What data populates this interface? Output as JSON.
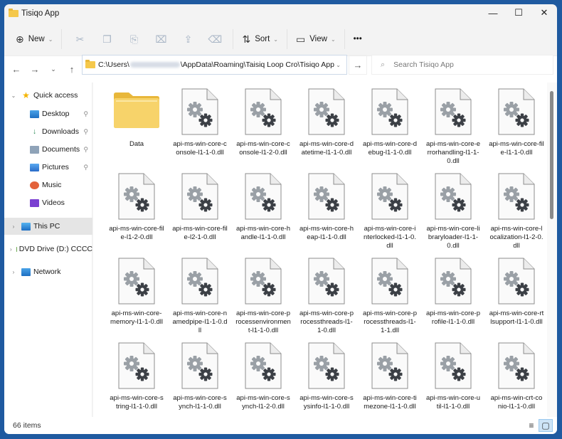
{
  "window": {
    "title": "Tisiqo App",
    "controls": {
      "minimize": "—",
      "maximize": "☐",
      "close": "✕"
    }
  },
  "toolbar": {
    "new_label": "New",
    "sort_label": "Sort",
    "view_label": "View",
    "more_label": "•••",
    "icons": {
      "new": "⊕",
      "cut": "✂",
      "copy": "❐",
      "paste": "📋",
      "rename": "⌧",
      "share": "⇪",
      "delete": "🗑",
      "sort": "⇅",
      "view": "▭"
    }
  },
  "navigation": {
    "back": "←",
    "forward": "→",
    "recent": "⌄",
    "up": "↑",
    "address_prefix": "C:\\Users\\",
    "address_suffix": "\\AppData\\Roaming\\Taisiq Loop Cro\\Tisiqo App",
    "refresh": "→",
    "search_placeholder": "Search Tisiqo App",
    "search_icon": "⌕"
  },
  "sidebar": {
    "items": [
      {
        "label": "Quick access",
        "icon": "star-icon",
        "expander": "⌄",
        "pinned": false
      },
      {
        "label": "Desktop",
        "icon": "desktop-icon",
        "pinned": true
      },
      {
        "label": "Downloads",
        "icon": "download-icon",
        "pinned": true
      },
      {
        "label": "Documents",
        "icon": "documents-icon",
        "pinned": true
      },
      {
        "label": "Pictures",
        "icon": "pictures-icon",
        "pinned": true
      },
      {
        "label": "Music",
        "icon": "music-icon",
        "pinned": false
      },
      {
        "label": "Videos",
        "icon": "videos-icon",
        "pinned": false
      },
      {
        "label": "This PC",
        "icon": "computer-icon",
        "expander": "›",
        "selected": true
      },
      {
        "label": "DVD Drive (D:) CCCC",
        "icon": "dvd-icon",
        "expander": "›"
      },
      {
        "label": "Network",
        "icon": "network-icon",
        "expander": "›"
      }
    ],
    "pin_glyph": "📌"
  },
  "files": [
    {
      "name": "Data",
      "type": "folder"
    },
    {
      "name": "api-ms-win-core-console-l1-1-0.dll",
      "type": "dll"
    },
    {
      "name": "api-ms-win-core-console-l1-2-0.dll",
      "type": "dll"
    },
    {
      "name": "api-ms-win-core-datetime-l1-1-0.dll",
      "type": "dll"
    },
    {
      "name": "api-ms-win-core-debug-l1-1-0.dll",
      "type": "dll"
    },
    {
      "name": "api-ms-win-core-errorhandling-l1-1-0.dll",
      "type": "dll"
    },
    {
      "name": "api-ms-win-core-file-l1-1-0.dll",
      "type": "dll"
    },
    {
      "name": "api-ms-win-core-file-l1-2-0.dll",
      "type": "dll"
    },
    {
      "name": "api-ms-win-core-file-l2-1-0.dll",
      "type": "dll"
    },
    {
      "name": "api-ms-win-core-handle-l1-1-0.dll",
      "type": "dll"
    },
    {
      "name": "api-ms-win-core-heap-l1-1-0.dll",
      "type": "dll"
    },
    {
      "name": "api-ms-win-core-interlocked-l1-1-0.dll",
      "type": "dll"
    },
    {
      "name": "api-ms-win-core-libraryloader-l1-1-0.dll",
      "type": "dll"
    },
    {
      "name": "api-ms-win-core-localization-l1-2-0.dll",
      "type": "dll"
    },
    {
      "name": "api-ms-win-core-memory-l1-1-0.dll",
      "type": "dll"
    },
    {
      "name": "api-ms-win-core-namedpipe-l1-1-0.dll",
      "type": "dll"
    },
    {
      "name": "api-ms-win-core-processenvironment-l1-1-0.dll",
      "type": "dll"
    },
    {
      "name": "api-ms-win-core-processthreads-l1-1-0.dll",
      "type": "dll"
    },
    {
      "name": "api-ms-win-core-processthreads-l1-1-1.dll",
      "type": "dll"
    },
    {
      "name": "api-ms-win-core-profile-l1-1-0.dll",
      "type": "dll"
    },
    {
      "name": "api-ms-win-core-rtlsupport-l1-1-0.dll",
      "type": "dll"
    },
    {
      "name": "api-ms-win-core-string-l1-1-0.dll",
      "type": "dll"
    },
    {
      "name": "api-ms-win-core-synch-l1-1-0.dll",
      "type": "dll"
    },
    {
      "name": "api-ms-win-core-synch-l1-2-0.dll",
      "type": "dll"
    },
    {
      "name": "api-ms-win-core-sysinfo-l1-1-0.dll",
      "type": "dll"
    },
    {
      "name": "api-ms-win-core-timezone-l1-1-0.dll",
      "type": "dll"
    },
    {
      "name": "api-ms-win-core-util-l1-1-0.dll",
      "type": "dll"
    },
    {
      "name": "api-ms-win-crt-conio-l1-1-0.dll",
      "type": "dll"
    }
  ],
  "status": {
    "item_count": "66 items",
    "details_view_icon": "≡",
    "tiles_view_icon": "▢"
  },
  "colors": {
    "desktop_bg": "#1f5aa0",
    "folder": "#f5c84b",
    "selection": "#e5e5e5",
    "gear_light": "#9aa0a6",
    "gear_dark": "#3c4046"
  }
}
